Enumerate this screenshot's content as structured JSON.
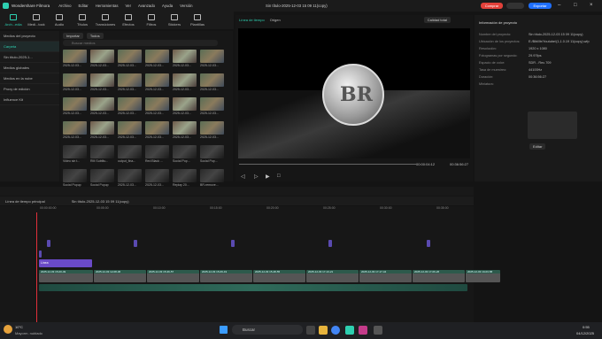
{
  "app": {
    "title": "Wondershare Filmora",
    "project_title": "Sin título-2025-12-03 15 09 11(copy)"
  },
  "menu": [
    "Archivo",
    "Editar",
    "Herramientas",
    "Ver",
    "Avanzado",
    "Ayuda",
    "Versión"
  ],
  "topbar": {
    "comprar": "Comprar",
    "exportar": "Exportar",
    "comprar_color": "#e2413a",
    "exportar_color": "#1f6fff"
  },
  "toolbar": [
    {
      "label": "Arch...edia",
      "icon": "media-icon"
    },
    {
      "label": "Medi...tock",
      "icon": "stock-icon"
    },
    {
      "label": "Audio",
      "icon": "audio-icon"
    },
    {
      "label": "Títulos",
      "icon": "titles-icon"
    },
    {
      "label": "Transiciones",
      "icon": "transitions-icon"
    },
    {
      "label": "Efectos",
      "icon": "effects-icon"
    },
    {
      "label": "Filtros",
      "icon": "filters-icon"
    },
    {
      "label": "Stickers",
      "icon": "stickers-icon"
    },
    {
      "label": "Plantillas",
      "icon": "templates-icon"
    }
  ],
  "sidebar": {
    "items": [
      "Medios del proyecto",
      "Carpeta",
      "Sin título-2025-1...",
      "Medios globales",
      "Medios en la nube",
      "Proxy de edición",
      "Influence Kit"
    ]
  },
  "media": {
    "import_label": "Importar",
    "filter_label": "Todos",
    "search_placeholder": "Buscar medios",
    "items": [
      {
        "label": "2025-12-03..."
      },
      {
        "label": "2025-12-03..."
      },
      {
        "label": "2025-12-03..."
      },
      {
        "label": "2025-12-03..."
      },
      {
        "label": "2025-12-03..."
      },
      {
        "label": "2025-12-03..."
      },
      {
        "label": "2025-12-03..."
      },
      {
        "label": "2025-12-03..."
      },
      {
        "label": "2025-12-03..."
      },
      {
        "label": "2025-12-03..."
      },
      {
        "label": "2025-12-03..."
      },
      {
        "label": "2025-12-03..."
      },
      {
        "label": "2025-12-03..."
      },
      {
        "label": "2025-12-03..."
      },
      {
        "label": "2025-12-03..."
      },
      {
        "label": "2025-12-03..."
      },
      {
        "label": "2025-12-03..."
      },
      {
        "label": "2025-12-03..."
      },
      {
        "label": "2025-12-03..."
      },
      {
        "label": "2025-12-03..."
      },
      {
        "label": "2025-12-03..."
      },
      {
        "label": "2025-12-03..."
      },
      {
        "label": "2025-12-03..."
      },
      {
        "label": "2025-12-03..."
      },
      {
        "label": "Video sin t..."
      },
      {
        "label": "RM Subtitu..."
      },
      {
        "label": "output_fina..."
      },
      {
        "label": "Red Black ..."
      },
      {
        "label": "Social Pop..."
      },
      {
        "label": "Social Pop..."
      },
      {
        "label": "Social Popup"
      },
      {
        "label": "Social Popup"
      },
      {
        "label": "2025-12-03..."
      },
      {
        "label": "2025-12-03..."
      },
      {
        "label": "Replay 20..."
      },
      {
        "label": "BR-remove..."
      }
    ]
  },
  "player": {
    "tab_timeline": "Línea de tiempo",
    "tab_origin": "Origen",
    "quality": "Calidad total",
    "current_time": "00:00:04:12",
    "total_time": "00:36:56:27",
    "coin_text": "BR"
  },
  "properties": {
    "header": "Información de proyecto",
    "rows": [
      {
        "k": "Nombre del proyecto:",
        "v": "Sin título-2025-12-03 15 09 11(copy)"
      },
      {
        "k": "Ubicación de los proyectos:",
        "v": "E:/Bibl/ltr/Youtube/(1,1.0.19 11(copy).wfp"
      },
      {
        "k": "Resolución:",
        "v": "1920 x 1080"
      },
      {
        "k": "Fotogramas por segundo:",
        "v": "29.97fps"
      },
      {
        "k": "Espacio de color:",
        "v": "SDR - Rec.709"
      },
      {
        "k": "Tasa de muestreo:",
        "v": "44100Hz"
      },
      {
        "k": "Duración:",
        "v": "00:36:56:27"
      },
      {
        "k": "Miniatura:",
        "v": ""
      }
    ],
    "edit_label": "Editar"
  },
  "timeline": {
    "header": "Línea de tiempo principal",
    "tab": "Sin título-2025-12-03 15 09 11(copy)",
    "ticks": [
      "00:00:00:00",
      "00:05:00",
      "00:10:00",
      "00:15:00",
      "00:20:00",
      "00:25:00",
      "00:30:00",
      "00:35:00"
    ],
    "text_clip": "Linea",
    "video_clips": [
      "2025-12-03 15-00-49",
      "2025-12-03 12-08-36",
      "2025-12-03 15-36-57",
      "2025-12-03 15-09-19",
      "2025-12-03 15-48-55",
      "2025-12-03 17-13-21",
      "2025-12-03 17-17-44",
      "2025-12-03 17-06-26",
      "2025-12-03 19-03-58"
    ]
  },
  "taskbar": {
    "weather_temp": "10°C",
    "weather_desc": "Mayorm. nublado",
    "search": "Buscar",
    "time": "0:55",
    "date": "04/12/2025"
  }
}
